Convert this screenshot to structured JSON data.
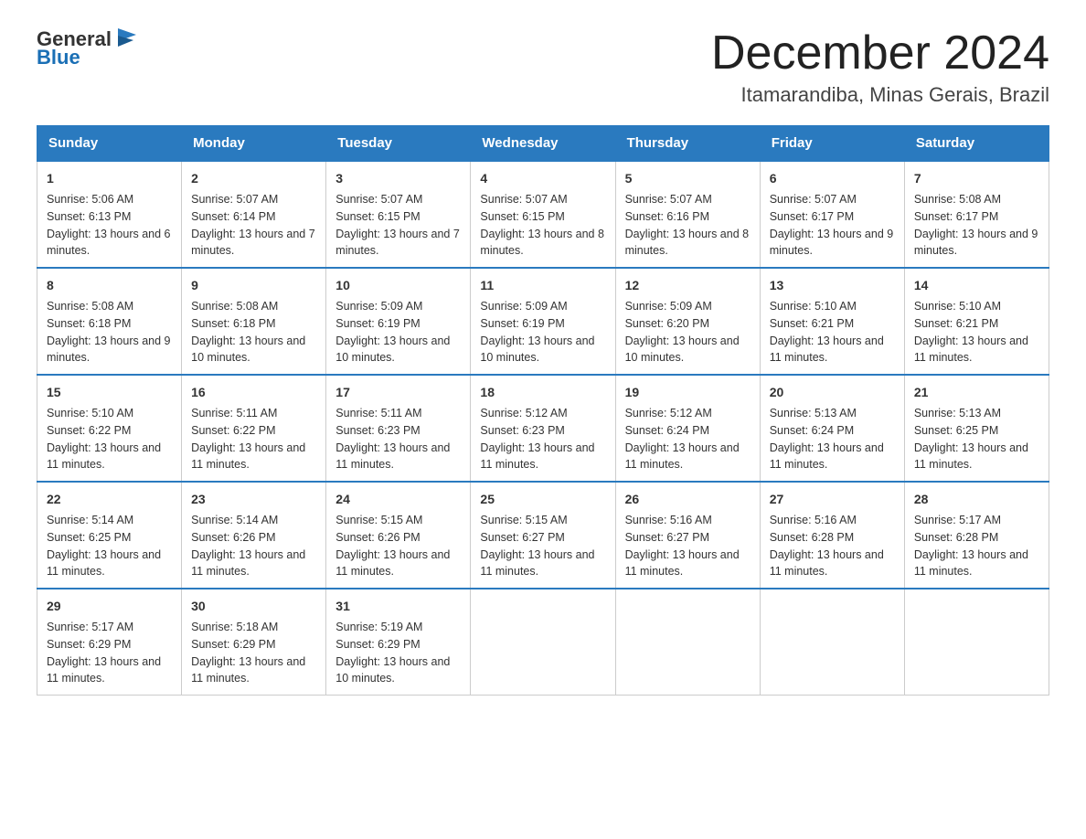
{
  "header": {
    "logo_general": "General",
    "logo_blue": "Blue",
    "month_title": "December 2024",
    "location": "Itamarandiba, Minas Gerais, Brazil"
  },
  "days_of_week": [
    "Sunday",
    "Monday",
    "Tuesday",
    "Wednesday",
    "Thursday",
    "Friday",
    "Saturday"
  ],
  "weeks": [
    [
      {
        "day": "1",
        "sunrise": "5:06 AM",
        "sunset": "6:13 PM",
        "daylight": "13 hours and 6 minutes."
      },
      {
        "day": "2",
        "sunrise": "5:07 AM",
        "sunset": "6:14 PM",
        "daylight": "13 hours and 7 minutes."
      },
      {
        "day": "3",
        "sunrise": "5:07 AM",
        "sunset": "6:15 PM",
        "daylight": "13 hours and 7 minutes."
      },
      {
        "day": "4",
        "sunrise": "5:07 AM",
        "sunset": "6:15 PM",
        "daylight": "13 hours and 8 minutes."
      },
      {
        "day": "5",
        "sunrise": "5:07 AM",
        "sunset": "6:16 PM",
        "daylight": "13 hours and 8 minutes."
      },
      {
        "day": "6",
        "sunrise": "5:07 AM",
        "sunset": "6:17 PM",
        "daylight": "13 hours and 9 minutes."
      },
      {
        "day": "7",
        "sunrise": "5:08 AM",
        "sunset": "6:17 PM",
        "daylight": "13 hours and 9 minutes."
      }
    ],
    [
      {
        "day": "8",
        "sunrise": "5:08 AM",
        "sunset": "6:18 PM",
        "daylight": "13 hours and 9 minutes."
      },
      {
        "day": "9",
        "sunrise": "5:08 AM",
        "sunset": "6:18 PM",
        "daylight": "13 hours and 10 minutes."
      },
      {
        "day": "10",
        "sunrise": "5:09 AM",
        "sunset": "6:19 PM",
        "daylight": "13 hours and 10 minutes."
      },
      {
        "day": "11",
        "sunrise": "5:09 AM",
        "sunset": "6:19 PM",
        "daylight": "13 hours and 10 minutes."
      },
      {
        "day": "12",
        "sunrise": "5:09 AM",
        "sunset": "6:20 PM",
        "daylight": "13 hours and 10 minutes."
      },
      {
        "day": "13",
        "sunrise": "5:10 AM",
        "sunset": "6:21 PM",
        "daylight": "13 hours and 11 minutes."
      },
      {
        "day": "14",
        "sunrise": "5:10 AM",
        "sunset": "6:21 PM",
        "daylight": "13 hours and 11 minutes."
      }
    ],
    [
      {
        "day": "15",
        "sunrise": "5:10 AM",
        "sunset": "6:22 PM",
        "daylight": "13 hours and 11 minutes."
      },
      {
        "day": "16",
        "sunrise": "5:11 AM",
        "sunset": "6:22 PM",
        "daylight": "13 hours and 11 minutes."
      },
      {
        "day": "17",
        "sunrise": "5:11 AM",
        "sunset": "6:23 PM",
        "daylight": "13 hours and 11 minutes."
      },
      {
        "day": "18",
        "sunrise": "5:12 AM",
        "sunset": "6:23 PM",
        "daylight": "13 hours and 11 minutes."
      },
      {
        "day": "19",
        "sunrise": "5:12 AM",
        "sunset": "6:24 PM",
        "daylight": "13 hours and 11 minutes."
      },
      {
        "day": "20",
        "sunrise": "5:13 AM",
        "sunset": "6:24 PM",
        "daylight": "13 hours and 11 minutes."
      },
      {
        "day": "21",
        "sunrise": "5:13 AM",
        "sunset": "6:25 PM",
        "daylight": "13 hours and 11 minutes."
      }
    ],
    [
      {
        "day": "22",
        "sunrise": "5:14 AM",
        "sunset": "6:25 PM",
        "daylight": "13 hours and 11 minutes."
      },
      {
        "day": "23",
        "sunrise": "5:14 AM",
        "sunset": "6:26 PM",
        "daylight": "13 hours and 11 minutes."
      },
      {
        "day": "24",
        "sunrise": "5:15 AM",
        "sunset": "6:26 PM",
        "daylight": "13 hours and 11 minutes."
      },
      {
        "day": "25",
        "sunrise": "5:15 AM",
        "sunset": "6:27 PM",
        "daylight": "13 hours and 11 minutes."
      },
      {
        "day": "26",
        "sunrise": "5:16 AM",
        "sunset": "6:27 PM",
        "daylight": "13 hours and 11 minutes."
      },
      {
        "day": "27",
        "sunrise": "5:16 AM",
        "sunset": "6:28 PM",
        "daylight": "13 hours and 11 minutes."
      },
      {
        "day": "28",
        "sunrise": "5:17 AM",
        "sunset": "6:28 PM",
        "daylight": "13 hours and 11 minutes."
      }
    ],
    [
      {
        "day": "29",
        "sunrise": "5:17 AM",
        "sunset": "6:29 PM",
        "daylight": "13 hours and 11 minutes."
      },
      {
        "day": "30",
        "sunrise": "5:18 AM",
        "sunset": "6:29 PM",
        "daylight": "13 hours and 11 minutes."
      },
      {
        "day": "31",
        "sunrise": "5:19 AM",
        "sunset": "6:29 PM",
        "daylight": "13 hours and 10 minutes."
      },
      null,
      null,
      null,
      null
    ]
  ],
  "labels": {
    "sunrise_prefix": "Sunrise: ",
    "sunset_prefix": "Sunset: ",
    "daylight_prefix": "Daylight: "
  }
}
